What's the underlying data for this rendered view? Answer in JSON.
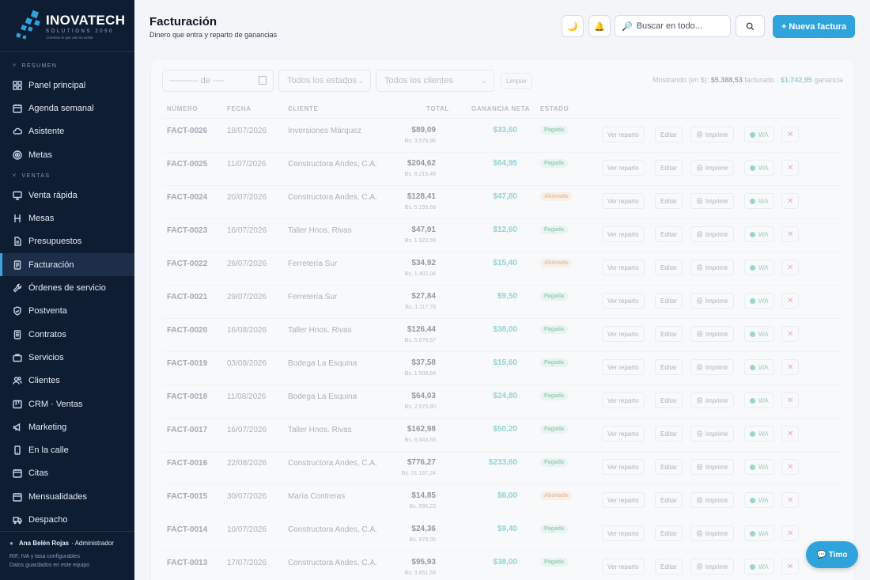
{
  "brand": {
    "name": "INOVATECH",
    "sub": "SOLUTIONS 2050",
    "tagline": "Creemos lo que aún no existe"
  },
  "sidebar": {
    "sections": [
      {
        "label": "RESUMEN",
        "items": [
          {
            "label": "Panel principal",
            "icon": "grid-icon"
          },
          {
            "label": "Agenda semanal",
            "icon": "calendar-icon"
          },
          {
            "label": "Asistente",
            "icon": "cloud-icon"
          },
          {
            "label": "Metas",
            "icon": "target-icon"
          }
        ]
      },
      {
        "label": "VENTAS",
        "items": [
          {
            "label": "Venta rápida",
            "icon": "monitor-icon"
          },
          {
            "label": "Mesas",
            "icon": "chair-icon"
          },
          {
            "label": "Presupuestos",
            "icon": "document-icon"
          },
          {
            "label": "Facturación",
            "icon": "invoice-icon",
            "active": true
          },
          {
            "label": "Órdenes de servicio",
            "icon": "wrench-icon"
          },
          {
            "label": "Postventa",
            "icon": "shield-icon"
          },
          {
            "label": "Contratos",
            "icon": "contract-icon"
          },
          {
            "label": "Servicios",
            "icon": "briefcase-icon"
          },
          {
            "label": "Clientes",
            "icon": "users-icon"
          },
          {
            "label": "CRM · Ventas",
            "icon": "kanban-icon"
          },
          {
            "label": "Marketing",
            "icon": "megaphone-icon"
          },
          {
            "label": "En la calle",
            "icon": "phone-icon"
          },
          {
            "label": "Citas",
            "icon": "calendar-icon"
          },
          {
            "label": "Mensualidades",
            "icon": "calendar-icon"
          },
          {
            "label": "Despacho",
            "icon": "truck-icon"
          }
        ]
      }
    ],
    "user": {
      "name": "Ana Belén Rojas",
      "role": "· Administrador"
    },
    "foot_lines": [
      "RIF, IVA y tasa configurables",
      "Datos guardados en este equipo"
    ]
  },
  "header": {
    "title": "Facturación",
    "subtitle": "Dinero que entra y reparto de ganancias",
    "search_placeholder": "Buscar en todo...",
    "new_button": "+ Nueva factura"
  },
  "filters": {
    "date_placeholder": "---------- de ----",
    "status_select": "Todos los estados",
    "client_select": "Todos los clientes",
    "clear_label": "Limpiar",
    "showing_prefix": "Mostrando (en $):",
    "showing_billed": "$5.388,53",
    "showing_mid": "facturado ·",
    "showing_profit": "$1.742,95",
    "showing_suffix": "ganancia"
  },
  "table": {
    "headers": [
      "NÚMERO",
      "FECHA",
      "CLIENTE",
      "TOTAL",
      "GANANCIA NETA",
      "ESTADO"
    ],
    "actions": {
      "view": "Ver reparto",
      "edit": "Editar",
      "print": "Imprimir",
      "wa": "WA",
      "delete": "✕"
    },
    "rows": [
      {
        "num": "FACT-0026",
        "date": "18/07/2026",
        "client": "Inversiones Márquez",
        "total": "$89,09",
        "bs": "Bs. 3.576,96",
        "profit": "$33,60",
        "status": "Pagada"
      },
      {
        "num": "FACT-0025",
        "date": "11/07/2026",
        "client": "Constructora Andes, C.A.",
        "total": "$204,62",
        "bs": "Bs. 8.215,49",
        "profit": "$64,95",
        "status": "Pagada"
      },
      {
        "num": "FACT-0024",
        "date": "20/07/2026",
        "client": "Constructora Andes, C.A.",
        "total": "$128,41",
        "bs": "Bs. 5.155,66",
        "profit": "$47,80",
        "status": "Abonada"
      },
      {
        "num": "FACT-0023",
        "date": "16/07/2026",
        "client": "Taller Hnos. Rivas",
        "total": "$47,91",
        "bs": "Bs. 1.923,59",
        "profit": "$12,60",
        "status": "Pagada"
      },
      {
        "num": "FACT-0022",
        "date": "26/07/2026",
        "client": "Ferretería Sur",
        "total": "$34,92",
        "bs": "Bs. 1.402,04",
        "profit": "$15,40",
        "status": "Abonada"
      },
      {
        "num": "FACT-0021",
        "date": "29/07/2026",
        "client": "Ferretería Sur",
        "total": "$27,84",
        "bs": "Bs. 1.117,78",
        "profit": "$9,50",
        "status": "Pagada"
      },
      {
        "num": "FACT-0020",
        "date": "16/08/2026",
        "client": "Taller Hnos. Rivas",
        "total": "$126,44",
        "bs": "Bs. 5.076,57",
        "profit": "$38,00",
        "status": "Pagada"
      },
      {
        "num": "FACT-0019",
        "date": "03/08/2026",
        "client": "Bodega La Esquina",
        "total": "$37,58",
        "bs": "Bs. 1.508,84",
        "profit": "$15,60",
        "status": "Pagada"
      },
      {
        "num": "FACT-0018",
        "date": "11/08/2026",
        "client": "Bodega La Esquina",
        "total": "$64,03",
        "bs": "Bs. 2.570,80",
        "profit": "$24,80",
        "status": "Pagada"
      },
      {
        "num": "FACT-0017",
        "date": "16/07/2026",
        "client": "Taller Hnos. Rivas",
        "total": "$162,98",
        "bs": "Bs. 6.543,65",
        "profit": "$50,20",
        "status": "Pagada"
      },
      {
        "num": "FACT-0016",
        "date": "22/08/2026",
        "client": "Constructora Andes, C.A.",
        "total": "$776,27",
        "bs": "Bs. 31.167,24",
        "profit": "$233,60",
        "status": "Pagada"
      },
      {
        "num": "FACT-0015",
        "date": "30/07/2026",
        "client": "María Contreras",
        "total": "$14,85",
        "bs": "Bs. 596,23",
        "profit": "$6,00",
        "status": "Abonada"
      },
      {
        "num": "FACT-0014",
        "date": "10/07/2026",
        "client": "Constructora Andes, C.A.",
        "total": "$24,36",
        "bs": "Bs. 978,05",
        "profit": "$9,40",
        "status": "Pagada"
      },
      {
        "num": "FACT-0013",
        "date": "17/07/2026",
        "client": "Constructora Andes, C.A.",
        "total": "$95,93",
        "bs": "Bs. 3.851,59",
        "profit": "$38,00",
        "status": "Pagada"
      }
    ]
  },
  "assistant_button": "💬 Timo",
  "colors": {
    "sidebar_bg": "#0f1d33",
    "accent": "#2ea3dc",
    "profit": "#0ea5a4",
    "paid": "#1f9d61",
    "partial": "#d97a27"
  }
}
